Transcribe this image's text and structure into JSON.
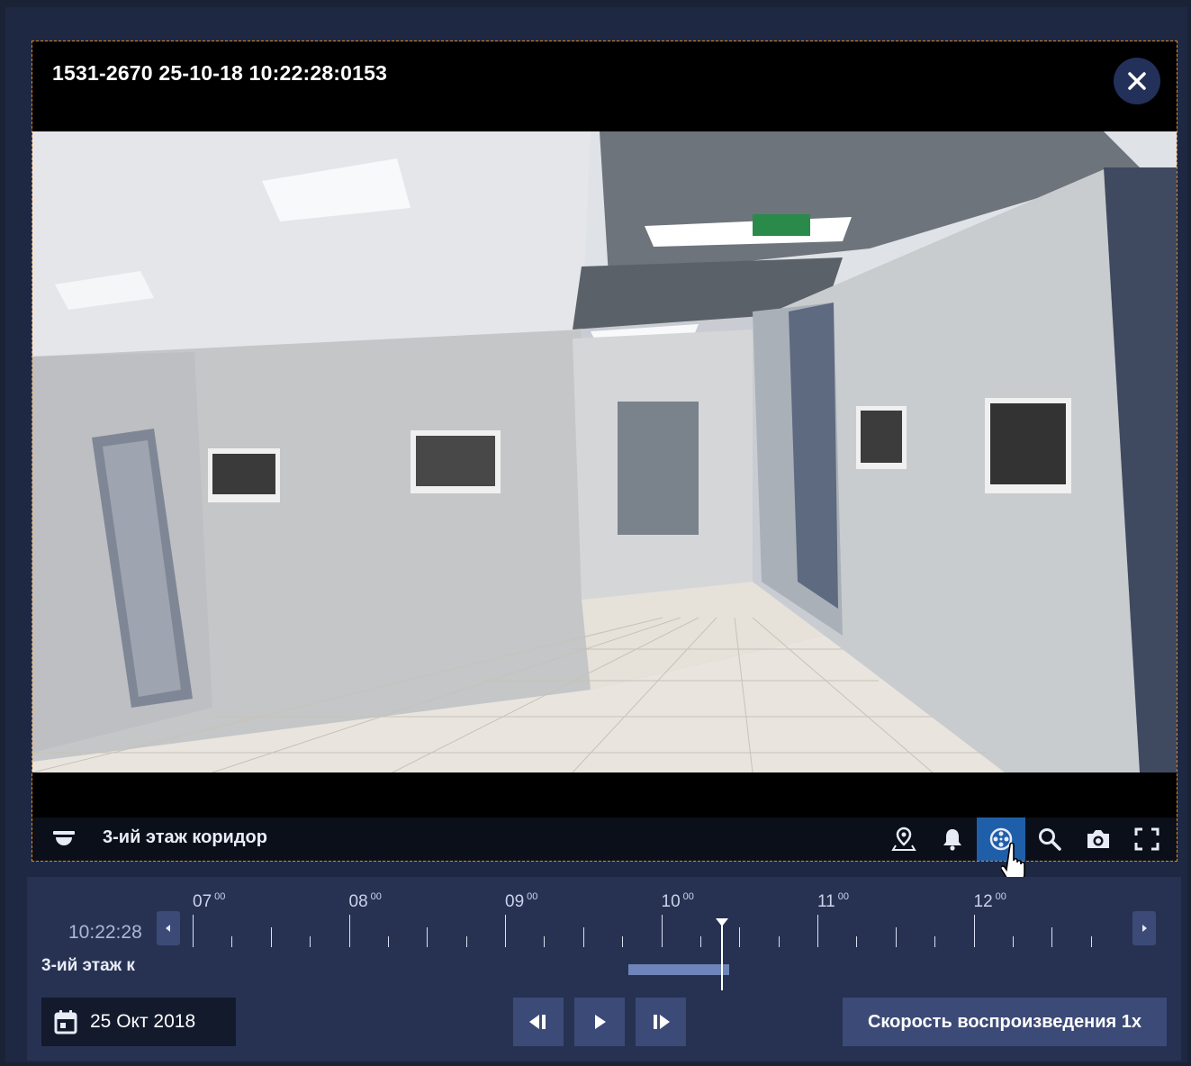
{
  "video": {
    "title": "1531-2670 25-10-18 10:22:28:0153",
    "camera_label": "3-ий этаж коридор"
  },
  "toolbar": {
    "icons": [
      "map-pin-icon",
      "bell-icon",
      "film-reel-icon",
      "search-icon",
      "camera-icon",
      "fullscreen-icon"
    ],
    "active_icon": "film-reel-icon"
  },
  "timeline": {
    "current_time": "10:22:28",
    "camera_label": "3-ий этаж к",
    "hours": [
      {
        "h": "07",
        "m": "00"
      },
      {
        "h": "08",
        "m": "00"
      },
      {
        "h": "09",
        "m": "00"
      },
      {
        "h": "10",
        "m": "00"
      },
      {
        "h": "11",
        "m": "00"
      },
      {
        "h": "12",
        "m": "00"
      }
    ],
    "recording_segment": {
      "start": "10:00",
      "end": "10:40"
    },
    "playhead_time": "10:22:28"
  },
  "controls": {
    "date": "25 Окт 2018",
    "speed_label": "Скорость воспроизведения 1x"
  },
  "colors": {
    "accent_dashed": "#e08a1e",
    "active_button": "#1f5faa",
    "panel": "#273253"
  }
}
